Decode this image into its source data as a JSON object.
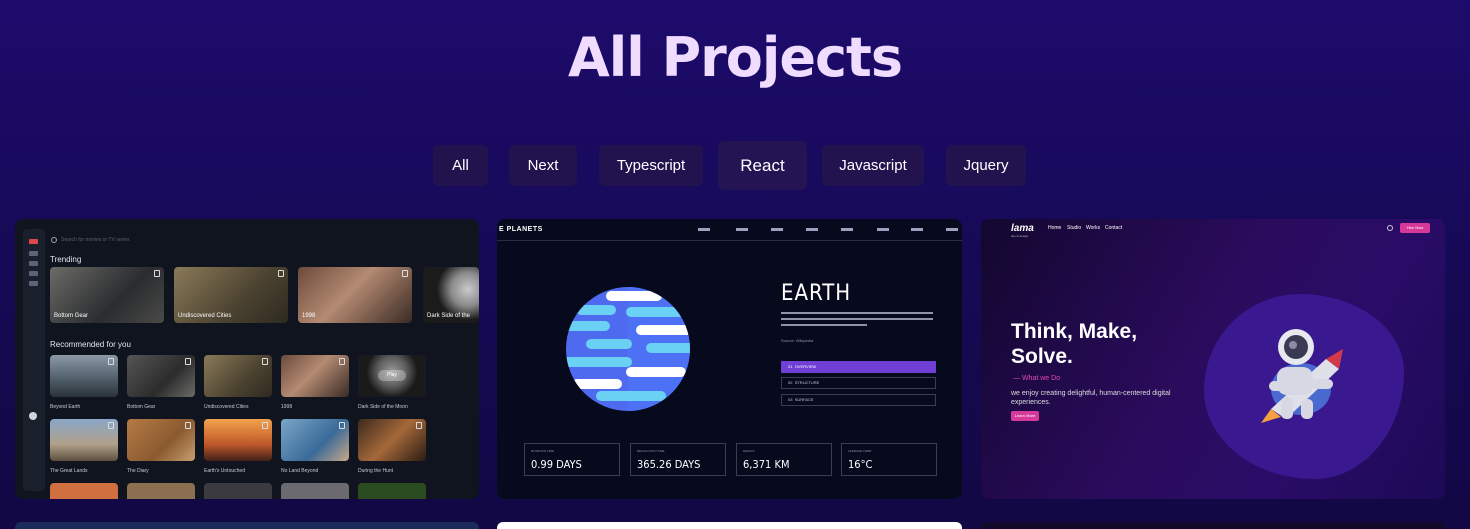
{
  "page": {
    "title": "All Projects"
  },
  "filters": [
    {
      "label": "All",
      "active": false
    },
    {
      "label": "Next",
      "active": false
    },
    {
      "label": "Typescript",
      "active": false
    },
    {
      "label": "React",
      "active": true
    },
    {
      "label": "Javascript",
      "active": false
    },
    {
      "label": "Jquery",
      "active": false
    }
  ],
  "projects": {
    "streaming": {
      "search_placeholder": "Search for movies or TV series",
      "section_trending": "Trending",
      "section_recommended": "Recommended for you",
      "trending": [
        "Bottom Gear",
        "Undiscovered Cities",
        "1998",
        "Dark Side of the"
      ],
      "recommended_row1": [
        "Beyond Earth",
        "Bottom Gear",
        "Undiscovered Cities",
        "1998",
        "Dark Side of the Moon"
      ],
      "recommended_row2": [
        "The Great Lands",
        "The Diary",
        "Earth's Untouched",
        "No Land Beyond",
        "During the Hunt"
      ],
      "play_label": "Play"
    },
    "planets": {
      "brand": "E PLANETS",
      "planet_name": "EARTH",
      "source": "Source: Wikipedia",
      "tabs": [
        {
          "num": "01",
          "label": "OVERVIEW",
          "active": true
        },
        {
          "num": "02",
          "label": "STRUCTURE",
          "active": false
        },
        {
          "num": "03",
          "label": "SURFACE",
          "active": false
        }
      ],
      "stats": [
        {
          "label": "ROTATION TIME",
          "value": "0.99 DAYS"
        },
        {
          "label": "REVOLUTION TIME",
          "value": "365.26 DAYS"
        },
        {
          "label": "RADIUS",
          "value": "6,371 KM"
        },
        {
          "label": "AVERAGE TEMP.",
          "value": "16°C"
        }
      ]
    },
    "lama": {
      "logo": "lama",
      "logo_sub": "dev & design",
      "nav": [
        "Home",
        "Studio",
        "Works",
        "Contact"
      ],
      "hire_label": "Hire Now",
      "hero": "Think, Make, Solve.",
      "what_we_do": "— What we Do",
      "description": "we enjoy creating delightful, human-centered digital experiences.",
      "learn_label": "Learn More"
    }
  }
}
